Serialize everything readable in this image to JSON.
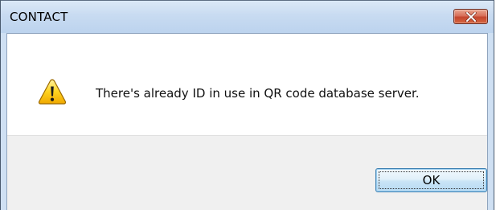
{
  "dialog": {
    "title": "CONTACT",
    "message": "There's already ID in use in QR code database server.",
    "ok_label": "OK",
    "icon": "warning-icon",
    "close_icon": "close-icon"
  },
  "colors": {
    "titlebar": "#c8dbf1",
    "close_button": "#c4462e",
    "footer": "#f0f0f0",
    "ok_border": "#3c7fb1"
  }
}
